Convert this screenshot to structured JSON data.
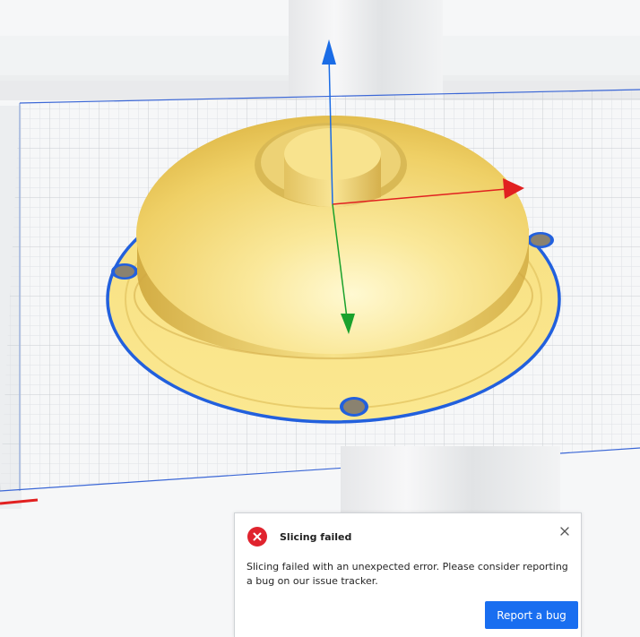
{
  "viewport": {
    "model": "dome-shaped part with flange and three mounting holes",
    "selection_color": "#2260dd",
    "model_color": "#f5dc73",
    "axis_colors": {
      "x": "#e12020",
      "y": "#1aa12c",
      "z": "#1a6ce6"
    },
    "build_plate_grid": true
  },
  "dialog": {
    "title": "Slicing failed",
    "message": "Slicing failed with an unexpected error. Please consider reporting a bug on our issue tracker.",
    "button_label": "Report a bug",
    "close_symbol": "×",
    "icon": "error-circle-x-icon",
    "accent_color": "#196ef0",
    "error_color": "#e0232e"
  }
}
